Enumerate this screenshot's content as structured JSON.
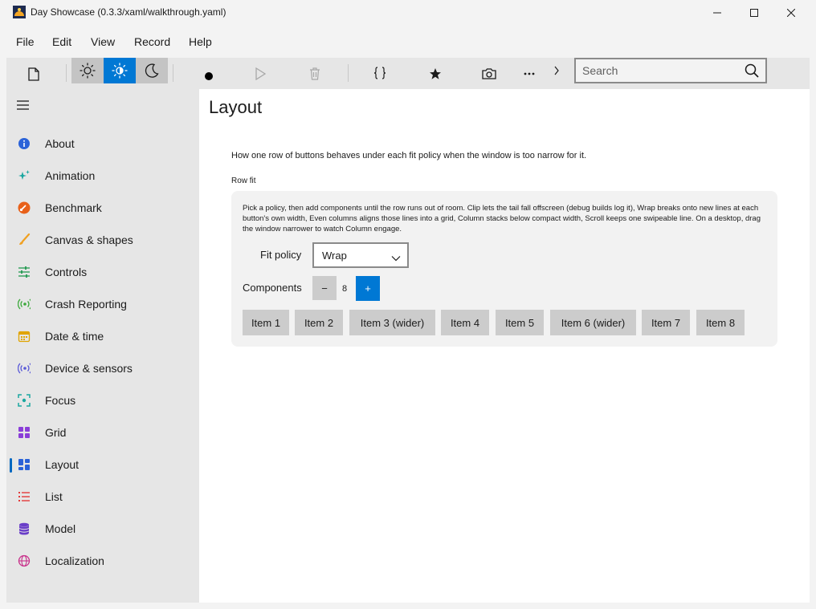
{
  "window": {
    "title": "Day Showcase (0.3.3/xaml/walkthrough.yaml)"
  },
  "menu": {
    "items": [
      "File",
      "Edit",
      "View",
      "Record",
      "Help"
    ]
  },
  "toolbar": {
    "theme_buttons": [
      "light-theme",
      "contrast-theme",
      "dark-theme"
    ],
    "active_theme": "contrast-theme",
    "search_placeholder": "Search"
  },
  "sidebar": {
    "items": [
      {
        "label": "About",
        "icon": "info-icon",
        "color": "#2a62d8"
      },
      {
        "label": "Animation",
        "icon": "sparkle-icon",
        "color": "#1aa7a0"
      },
      {
        "label": "Benchmark",
        "icon": "speedometer-icon",
        "color": "#e8611a"
      },
      {
        "label": "Canvas & shapes",
        "icon": "brush-icon",
        "color": "#f0a020"
      },
      {
        "label": "Controls",
        "icon": "sliders-icon",
        "color": "#2e9e5a"
      },
      {
        "label": "Crash Reporting",
        "icon": "broadcast-icon",
        "color": "#3aa83a"
      },
      {
        "label": "Date & time",
        "icon": "calendar-icon",
        "color": "#e0a400"
      },
      {
        "label": "Device & sensors",
        "icon": "sensor-icon",
        "color": "#5a5ad8"
      },
      {
        "label": "Focus",
        "icon": "focus-icon",
        "color": "#1aa7a0"
      },
      {
        "label": "Grid",
        "icon": "grid-icon",
        "color": "#8a3ed8"
      },
      {
        "label": "Layout",
        "icon": "layout-icon",
        "color": "#2a62d8"
      },
      {
        "label": "List",
        "icon": "list-icon",
        "color": "#e23a3a"
      },
      {
        "label": "Model",
        "icon": "database-icon",
        "color": "#6a3ec8"
      },
      {
        "label": "Localization",
        "icon": "globe-icon",
        "color": "#c8308a"
      }
    ],
    "selected": "Layout"
  },
  "main": {
    "title": "Layout",
    "intro": "How one row of buttons behaves under each fit policy when the window is too narrow for it.",
    "section_label": "Row fit",
    "description": "Pick a policy, then add components until the row runs out of room. Clip lets the tail fall offscreen (debug builds log it), Wrap breaks onto new lines at each button's own width, Even columns aligns those lines into a grid, Column stacks below compact width, Scroll keeps one swipeable line. On a desktop, drag the window narrower to watch Column engage.",
    "fit_policy_label": "Fit policy",
    "fit_policy_value": "Wrap",
    "components_label": "Components",
    "components_count": "8",
    "minus_label": "−",
    "plus_label": "+",
    "items": [
      "Item 1",
      "Item 2",
      "Item 3 (wider)",
      "Item 4",
      "Item 5",
      "Item 6 (wider)",
      "Item 7",
      "Item 8"
    ]
  },
  "colors": {
    "accent": "#0078d4",
    "selection_indicator": "#0067c0"
  }
}
